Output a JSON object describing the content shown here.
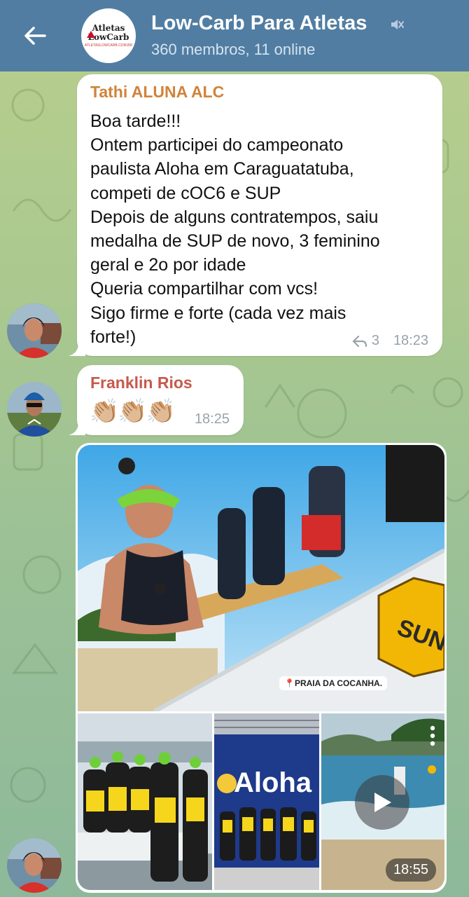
{
  "header": {
    "title": "Low-Carb Para Atletas",
    "subtitle": "360 membros, 11 online",
    "logo_line1": "Atletas",
    "logo_line2": "LowCarb",
    "logo_sub": "ATLETASLOWCARB.COM.BR"
  },
  "messages": [
    {
      "sender": "Tathi ALUNA ALC",
      "lines": [
        "Boa tarde!!!",
        "Ontem participei do campeonato",
        "paulista Aloha em Caraguatatuba,",
        "competi de cOC6 e SUP",
        "Depois de alguns contratempos, saiu",
        "medalha de SUP de novo, 3 feminino",
        "geral e 2o por idade",
        "Queria compartilhar com vcs!",
        "Sigo firme e forte (cada vez mais",
        "forte!)"
      ],
      "reply_count": "3",
      "time": "18:23"
    },
    {
      "sender": "Franklin Rios",
      "text": "👏🏼👏🏼👏🏼",
      "time": "18:25"
    },
    {
      "type": "album",
      "location_tag": "📍PRAIA DA COCANHA.",
      "sign_text": "Aloha",
      "time": "18:55"
    }
  ]
}
